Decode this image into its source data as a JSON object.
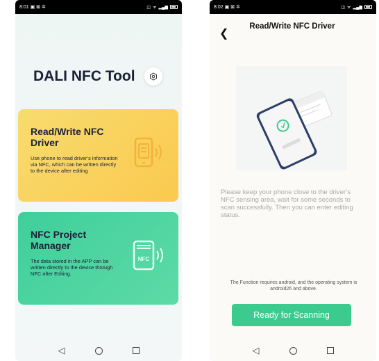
{
  "screen1": {
    "status": {
      "time": "8:01",
      "icons": "▣ ⊠ ✲"
    },
    "title": "DALI NFC Tool",
    "cards": [
      {
        "title": "Read/Write NFC Driver",
        "description": "Use phone to read driver’s information via NFC, which can be written directly to the device after editing",
        "icon": "phone-nfc-icon",
        "color": "#f9d35c"
      },
      {
        "title": "NFC Project Manager",
        "description": "The data stored in the APP can be written directly to the device through NFC after Editing.",
        "icon": "nfc-card-icon",
        "icon_text": "NFC",
        "color": "#4dd3a0"
      }
    ]
  },
  "screen2": {
    "status": {
      "time": "8:02",
      "icons": "▣ ⊠ ✲"
    },
    "title": "Read/Write NFC Driver",
    "instructions": "Please keep your phone close to the driver’s NFC sensing area, wait for some seconds to scan successfully. Then you can enter editing status.",
    "note": "The Function requires android, and the operating system is android26 and above.",
    "button": "Ready for Scanning",
    "accent": "#3ccb8e"
  },
  "nav": {
    "back": "◁"
  }
}
